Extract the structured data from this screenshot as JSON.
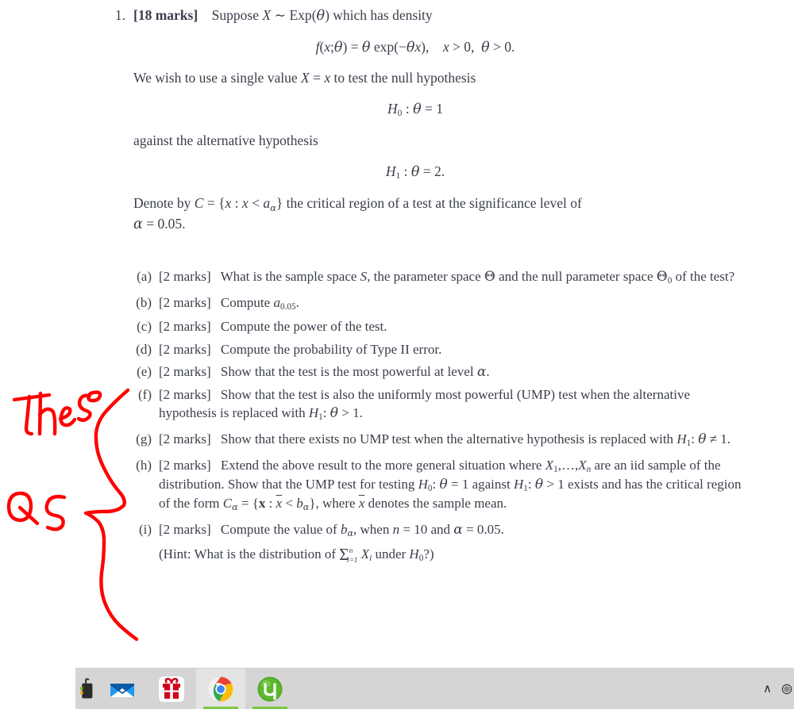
{
  "document": {
    "problem_number": "1.",
    "marks_label": "[18 marks]",
    "intro": "Suppose X ~ Exp(θ) which has density",
    "density_formula": "f(x; θ) = θ exp(−θx),    x > 0,  θ > 0.",
    "line_single_value": "We wish to use a single value X = x to test the null hypothesis",
    "null_hypothesis": "H₀ : θ = 1",
    "line_against": "against the alternative hypothesis",
    "alt_hypothesis": "H₁ : θ = 2.",
    "denote_line1": "Denote by C = {x : x < a_α} the critical region of a test at the significance level of",
    "denote_line2": "α = 0.05.",
    "subitems": [
      {
        "label": "(a)",
        "marks": "[2 marks]",
        "text": "What is the sample space S, the parameter space Θ and the null parameter space Θ₀ of the test?"
      },
      {
        "label": "(b)",
        "marks": "[2 marks]",
        "text": "Compute a₀.₀₅."
      },
      {
        "label": "(c)",
        "marks": "[2 marks]",
        "text": "Compute the power of the test."
      },
      {
        "label": "(d)",
        "marks": "[2 marks]",
        "text": "Compute the probability of Type II error."
      },
      {
        "label": "(e)",
        "marks": "[2 marks]",
        "text": "Show that the test is the most powerful at level α."
      },
      {
        "label": "(f)",
        "marks": "[2 marks]",
        "text": "Show that the test is also the uniformly most powerful (UMP) test when the alternative hypothesis is replaced with H₁: θ > 1."
      },
      {
        "label": "(g)",
        "marks": "[2 marks]",
        "text": "Show that there exists no UMP test when the alternative hypothesis is replaced with H₁: θ ≠ 1."
      },
      {
        "label": "(h)",
        "marks": "[2 marks]",
        "text": "Extend the above result to the more general situation where X₁,…,Xₙ are an iid sample of the distribution. Show that the UMP test for testing H₀: θ = 1 against H₁: θ > 1 exists and has the critical region of the form C_α = {x : x̄ < b_α}, where x̄ denotes the sample mean."
      },
      {
        "label": "(i)",
        "marks": "[2 marks]",
        "text": "Compute the value of b_α, when n = 10 and α = 0.05.",
        "hint": "(Hint: What is the distribution of Σⁿᵢ₌₁ Xᵢ under H₀?)"
      }
    ]
  },
  "annotation": {
    "color": "#ff0000",
    "note_1": "These",
    "note_2": "Qs",
    "brace_description": "large hand-drawn curly brace grouping items (e) through (i)"
  },
  "taskbar": {
    "background_color": "#d5d5d5",
    "items": [
      {
        "name": "clipped-app",
        "label": ""
      },
      {
        "name": "mail",
        "label": "Mail"
      },
      {
        "name": "gift",
        "label": "Gift"
      },
      {
        "name": "chrome",
        "label": "Google Chrome"
      },
      {
        "name": "utorrent",
        "label": "uTorrent"
      }
    ],
    "tray": {
      "chevron": "∧",
      "hidden_icons_label": "Show hidden icons"
    }
  }
}
